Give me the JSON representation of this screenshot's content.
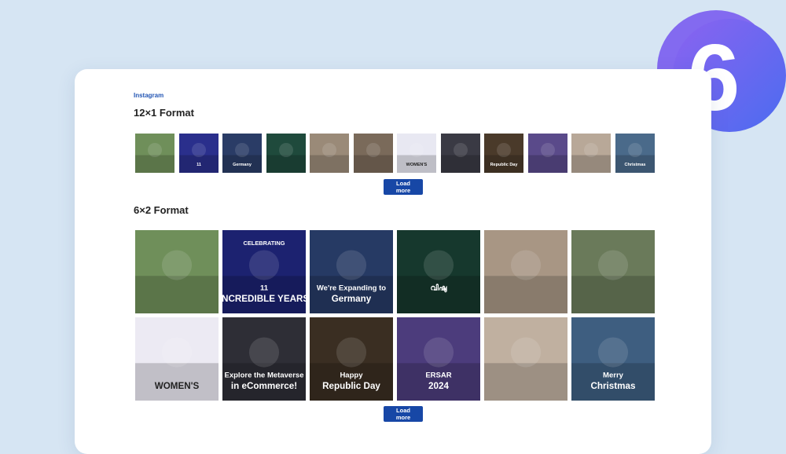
{
  "badge": {
    "digit": "6",
    "colors": [
      "#7a5cf0",
      "#4a6ff2"
    ]
  },
  "section": {
    "eyebrow": "Instagram"
  },
  "format1": {
    "title": "12×1 Format",
    "load_more": "Load more",
    "posts": [
      {
        "name": "group-photo",
        "bg": "#6f8f5a",
        "caption": ""
      },
      {
        "name": "celebrating-11-years",
        "bg": "#2a2f8c",
        "caption": "11"
      },
      {
        "name": "expanding-germany",
        "bg": "#2a3c66",
        "caption": "Germany"
      },
      {
        "name": "vishu-greeting",
        "bg": "#1f4a3c",
        "caption": ""
      },
      {
        "name": "office-team",
        "bg": "#9a8a78",
        "caption": ""
      },
      {
        "name": "women-saree-group",
        "bg": "#7a6a5a",
        "caption": ""
      },
      {
        "name": "womens-day",
        "bg": "#e8e8f2",
        "caption": "WOMEN'S"
      },
      {
        "name": "metaverse-ecommerce",
        "bg": "#3a3a44",
        "caption": ""
      },
      {
        "name": "republic-day",
        "bg": "#4a3a2a",
        "caption": "Republic Day"
      },
      {
        "name": "anniversary-award",
        "bg": "#5a4a8a",
        "caption": ""
      },
      {
        "name": "christmas-office",
        "bg": "#b8a898",
        "caption": ""
      },
      {
        "name": "merry-christmas",
        "bg": "#4a6a8a",
        "caption": "Christmas"
      }
    ]
  },
  "format2": {
    "title": "6×2 Format",
    "load_more": "Load more",
    "posts": [
      {
        "name": "group-photo",
        "bg": "#6f8f5a",
        "top": "",
        "mid": "",
        "bottom": ""
      },
      {
        "name": "celebrating-11-years",
        "bg": "#1c2270",
        "top": "CELEBRATING",
        "mid": "11",
        "bottom": "INCREDIBLE YEARS"
      },
      {
        "name": "expanding-germany",
        "bg": "#263a64",
        "top": "",
        "mid": "We're Expanding to",
        "bottom": "Germany"
      },
      {
        "name": "vishu-greeting",
        "bg": "#16382d",
        "top": "",
        "mid": "വിഷു",
        "bottom": ""
      },
      {
        "name": "office-team",
        "bg": "#a89684",
        "top": "",
        "mid": "",
        "bottom": ""
      },
      {
        "name": "women-saree-group",
        "bg": "#6a7a5a",
        "top": "",
        "mid": "",
        "bottom": ""
      },
      {
        "name": "womens-day",
        "bg": "#eceaf3",
        "top": "",
        "mid": "",
        "bottom": "WOMEN'S"
      },
      {
        "name": "metaverse-ecommerce",
        "bg": "#2e2e36",
        "top": "",
        "mid": "Explore the Metaverse",
        "bottom": "in eCommerce!"
      },
      {
        "name": "republic-day",
        "bg": "#3a2e22",
        "top": "",
        "mid": "Happy",
        "bottom": "Republic Day"
      },
      {
        "name": "anniversary-award",
        "bg": "#4c3c7c",
        "top": "",
        "mid": "ERSAR",
        "bottom": "2024"
      },
      {
        "name": "christmas-office",
        "bg": "#c0b0a0",
        "top": "",
        "mid": "",
        "bottom": ""
      },
      {
        "name": "merry-christmas",
        "bg": "#3e5e80",
        "top": "",
        "mid": "Merry",
        "bottom": "Christmas"
      }
    ]
  }
}
